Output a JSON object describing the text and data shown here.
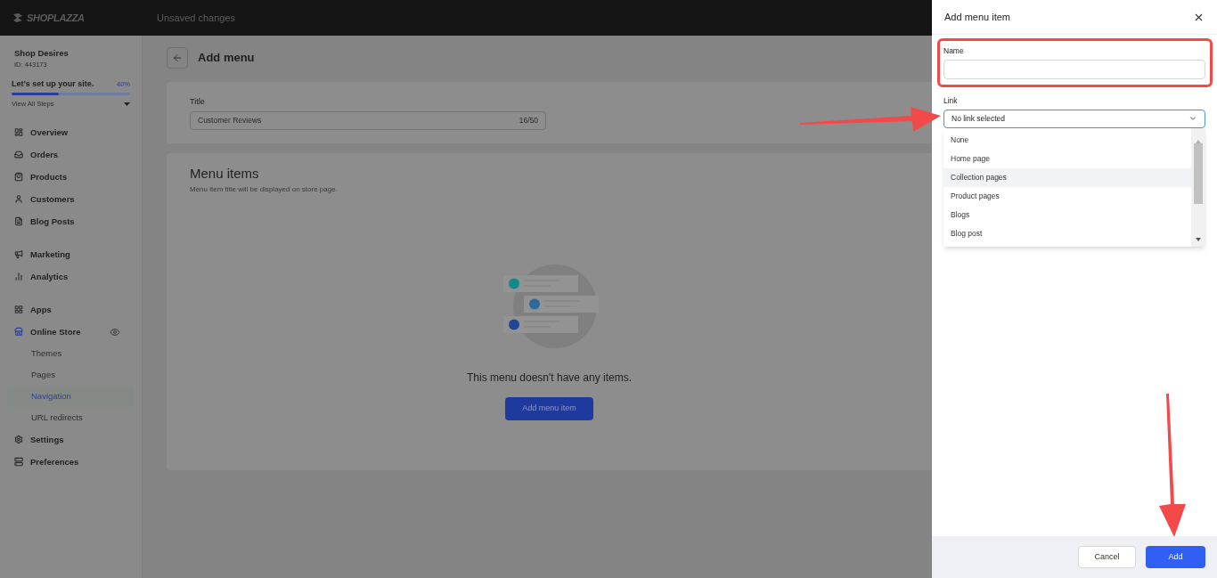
{
  "top_bar": {
    "logo_text": "SHOPLAZZA",
    "status": "Unsaved changes"
  },
  "sidebar": {
    "shop_name": "Shop Desires",
    "shop_id": "ID: 443173",
    "setup": {
      "text": "Let’s set up your site.",
      "percent": "40%",
      "level": 0.4,
      "link": "View All Steps"
    },
    "groups": [
      [
        {
          "label": "Overview",
          "selected": false
        },
        {
          "label": "Orders",
          "selected": false
        },
        {
          "label": "Products",
          "selected": false
        },
        {
          "label": "Customers",
          "selected": false
        },
        {
          "label": "Blog Posts",
          "selected": false
        }
      ],
      [
        {
          "label": "Marketing",
          "selected": false
        },
        {
          "label": "Analytics",
          "selected": false
        }
      ],
      [
        {
          "label": "Apps",
          "selected": false
        },
        {
          "label": "Online Store",
          "selected": false,
          "children": [
            {
              "label": "Themes",
              "selected": false
            },
            {
              "label": "Pages",
              "selected": false
            },
            {
              "label": "Navigation",
              "selected": true
            },
            {
              "label": "URL redirects",
              "selected": false
            }
          ]
        },
        {
          "label": "Settings",
          "selected": false
        },
        {
          "label": "Preferences",
          "selected": false
        }
      ]
    ]
  },
  "page": {
    "title": "Add menu",
    "title_card": {
      "label": "Title",
      "value": "Customer Reviews",
      "counter": "16/50"
    },
    "menu_items_card": {
      "heading": "Menu items",
      "subtitle": "Menu item title will be displayed on store page.",
      "empty_message": "This menu doesn't have any items.",
      "button": "Add menu item"
    }
  },
  "drawer": {
    "title": "Add menu item",
    "name_label": "Name",
    "link_label": "Link",
    "link_value": "No link selected",
    "options": [
      {
        "label": "None",
        "selected": false
      },
      {
        "label": "Home page",
        "selected": false
      },
      {
        "label": "Collection pages",
        "selected": true
      },
      {
        "label": "Product pages",
        "selected": false
      },
      {
        "label": "Blogs",
        "selected": false
      },
      {
        "label": "Blog post",
        "selected": false
      }
    ],
    "buttons": {
      "cancel": "Cancel",
      "confirm": "Add"
    }
  }
}
